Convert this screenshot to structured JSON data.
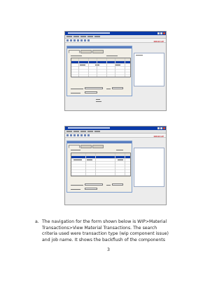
{
  "document": {
    "list_marker": "a.",
    "paragraph_lines": [
      "The navigation for the  form shown below is WIP>Material",
      "Transactions>View  Material  Transactions.   The  search",
      "criteria  used were  transaction type (wip component issue)",
      "and job name. It shows the backflush of the components"
    ],
    "page_number": "3"
  },
  "screenshots": {
    "brand_text": "ORACLE",
    "titlebar_color": "#0a3aa8",
    "selection_color": "#0a3aa8",
    "brand_color": "#c1272d"
  }
}
